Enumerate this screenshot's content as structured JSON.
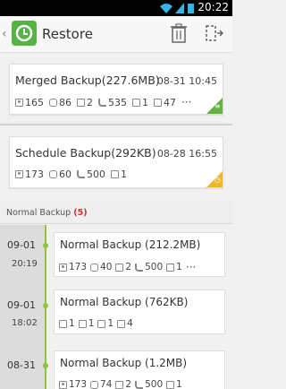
{
  "status_bar": {
    "time": "20:22"
  },
  "app_bar": {
    "title": "Restore"
  },
  "cards": [
    {
      "name": "Merged Backup(227.6MB)",
      "date": "08-31 10:45",
      "stats": [
        {
          "icon": "contacts-icon",
          "value": "165"
        },
        {
          "icon": "messages-icon",
          "value": "86"
        },
        {
          "icon": "mms-icon",
          "value": "2"
        },
        {
          "icon": "call-log-icon",
          "value": "535"
        },
        {
          "icon": "calendar-icon",
          "value": "1"
        },
        {
          "icon": "apps-icon",
          "value": "47"
        }
      ],
      "badge_color": "#62b23d"
    },
    {
      "name": "Schedule Backup(292KB)",
      "date": "08-28 16:55",
      "stats": [
        {
          "icon": "contacts-icon",
          "value": "173"
        },
        {
          "icon": "messages-icon",
          "value": "60"
        },
        {
          "icon": "call-log-icon",
          "value": "500"
        },
        {
          "icon": "calendar-icon",
          "value": "1"
        }
      ],
      "badge_color": "#f0b62b"
    }
  ],
  "section": {
    "title": "Normal Backup",
    "count": "(5)"
  },
  "timeline": [
    {
      "date": "09-01",
      "time": "20:19",
      "name": "Normal Backup (212.2MB)",
      "stats": [
        {
          "icon": "contacts-icon",
          "value": "173"
        },
        {
          "icon": "messages-icon",
          "value": "40"
        },
        {
          "icon": "mms-icon",
          "value": "2"
        },
        {
          "icon": "call-log-icon",
          "value": "500"
        },
        {
          "icon": "calendar-icon",
          "value": "1"
        }
      ]
    },
    {
      "date": "09-01",
      "time": "18:02",
      "name": "Normal Backup (762KB)",
      "stats": [
        {
          "icon": "calendar-icon",
          "value": "1"
        },
        {
          "icon": "notes-icon",
          "value": "1"
        },
        {
          "icon": "settings-icon",
          "value": "1"
        },
        {
          "icon": "bookmarks-icon",
          "value": "4"
        }
      ]
    },
    {
      "date": "08-31",
      "time": "",
      "name": "Normal Backup (1.2MB)",
      "stats": [
        {
          "icon": "contacts-icon",
          "value": "173"
        },
        {
          "icon": "messages-icon",
          "value": "74"
        },
        {
          "icon": "mms-icon",
          "value": "2"
        },
        {
          "icon": "call-log-icon",
          "value": "500"
        },
        {
          "icon": "calendar-icon",
          "value": "1"
        }
      ]
    }
  ],
  "colors": {
    "accent_green": "#8cc63f",
    "count_red": "#d32f2f"
  }
}
